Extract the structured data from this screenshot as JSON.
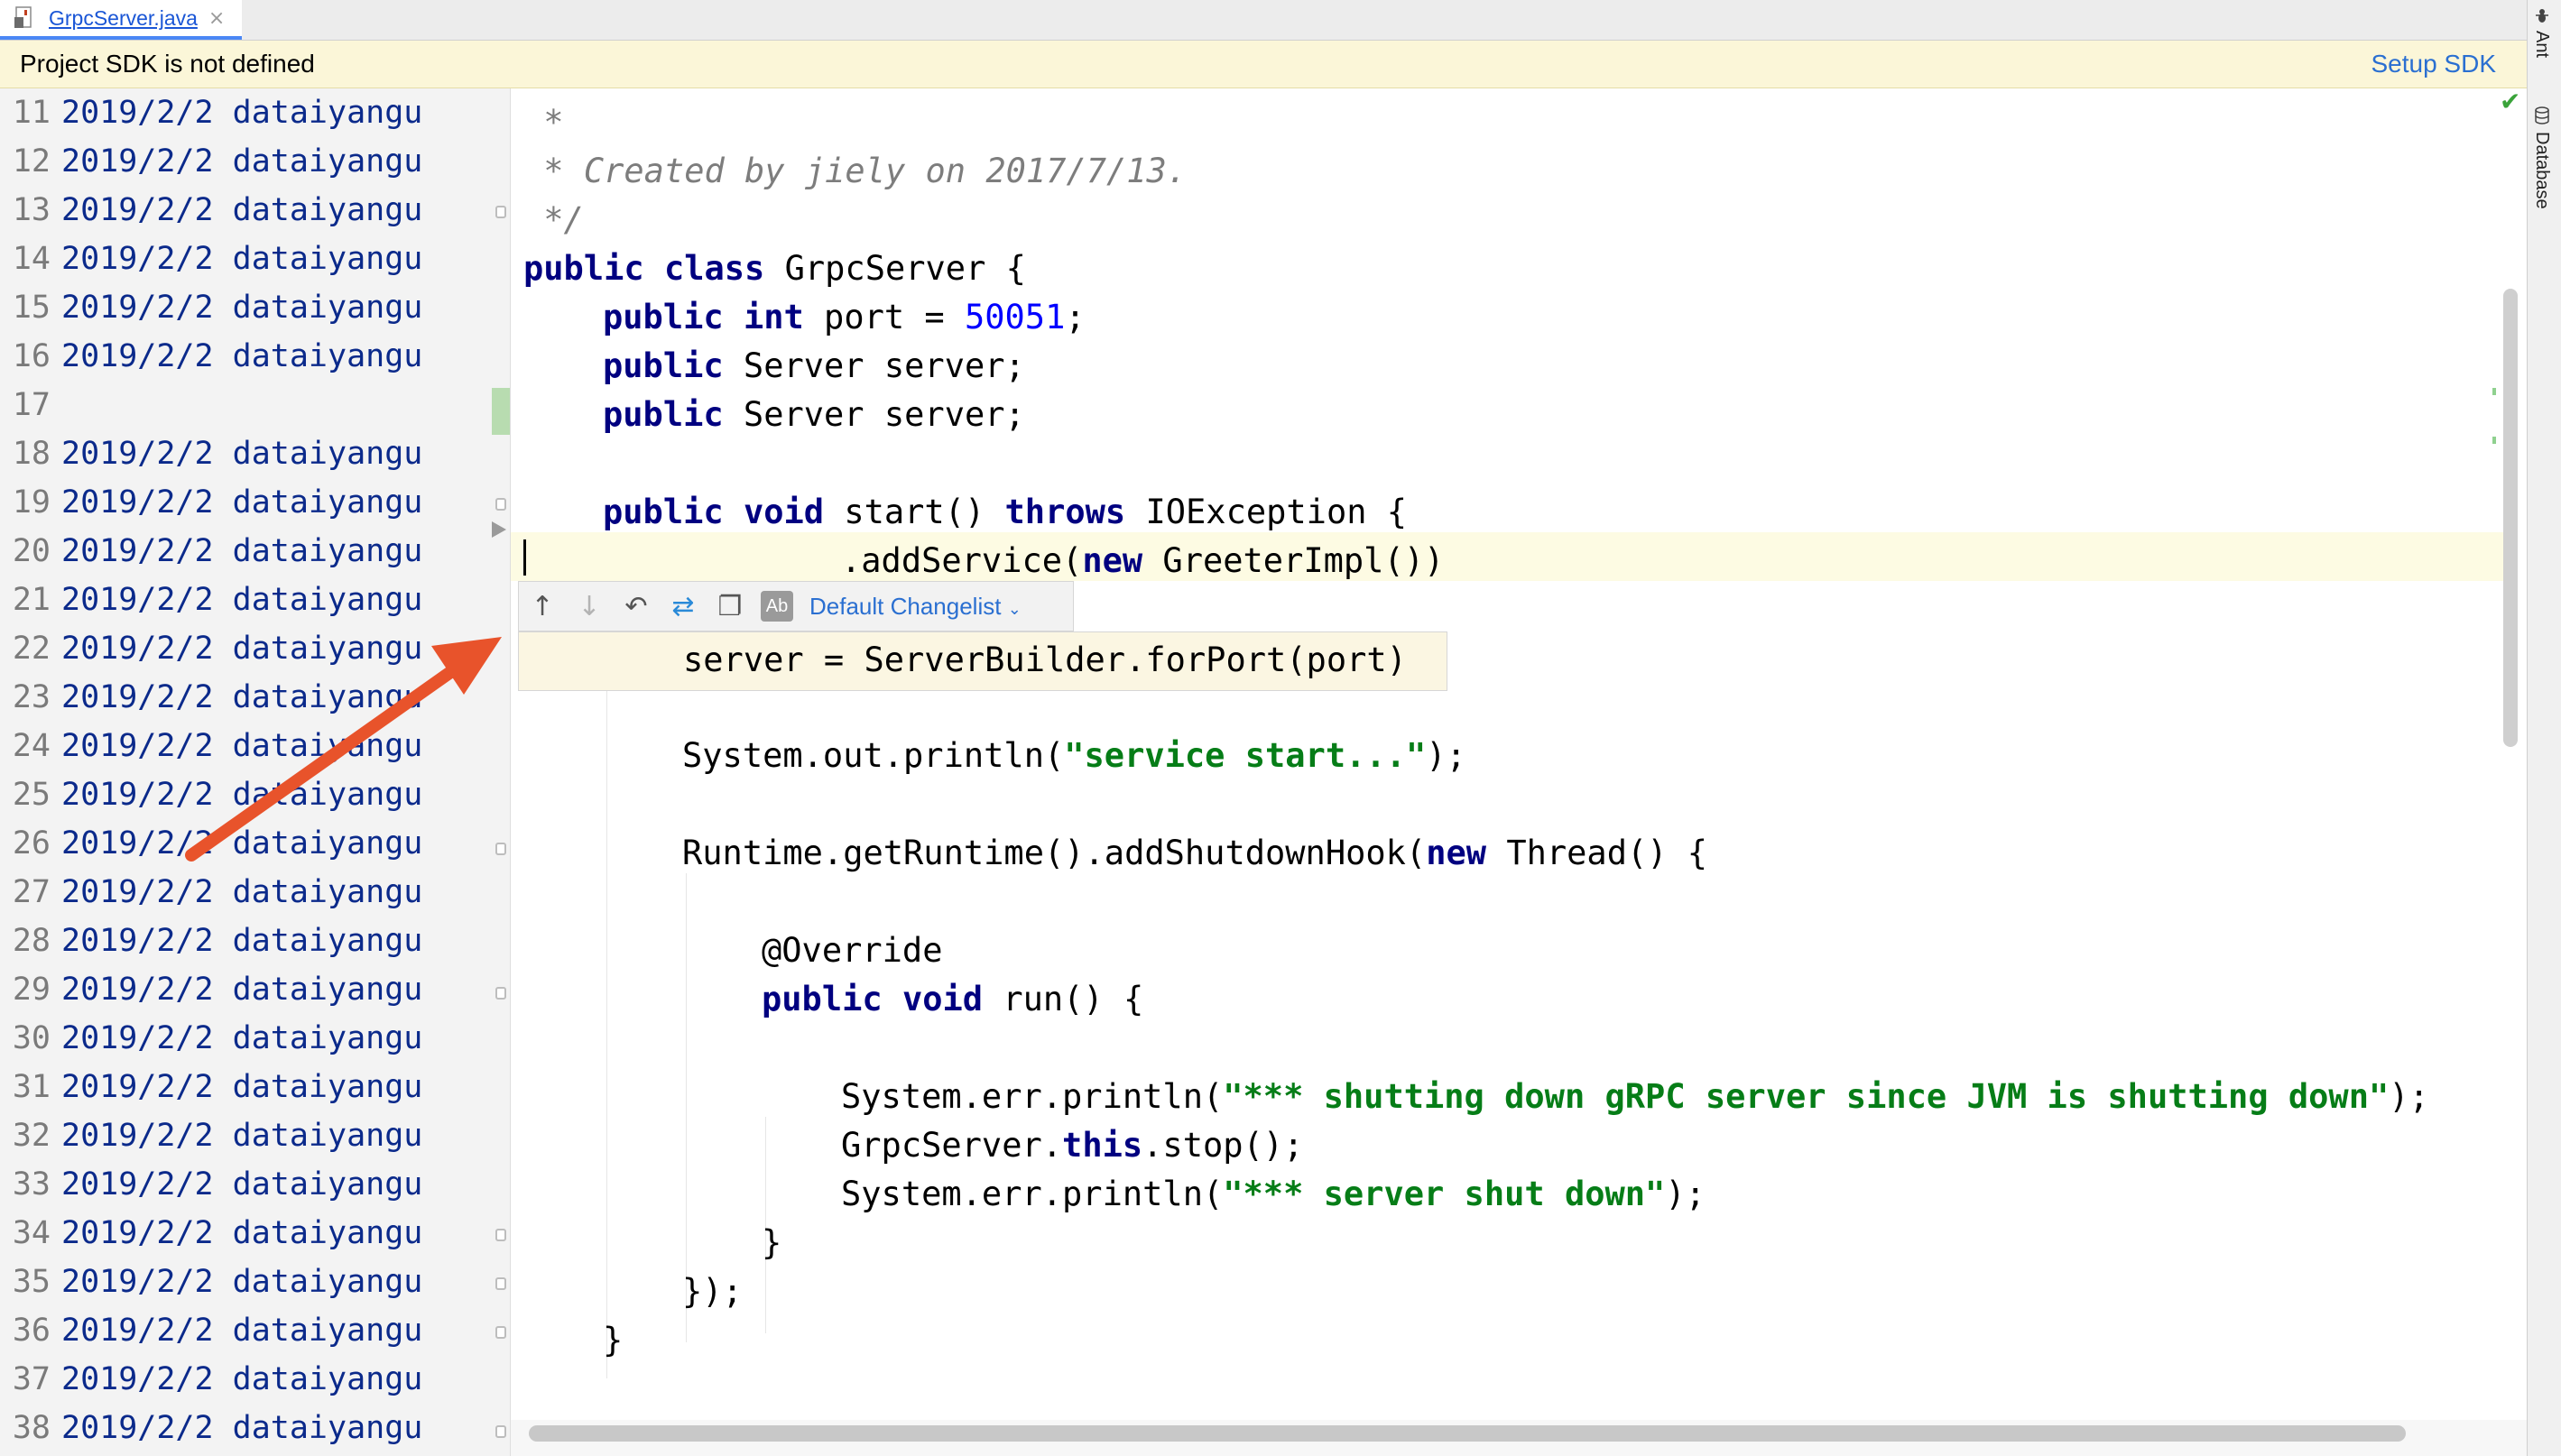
{
  "tab": {
    "file_name": "GrpcServer.java",
    "close_glyph": "×",
    "icon": "java-file-icon"
  },
  "notification": {
    "message": "Project SDK is not defined",
    "action": "Setup SDK"
  },
  "tool_windows": {
    "ant": "Ant",
    "database": "Database"
  },
  "annotations": [
    {
      "line": "11",
      "text": "2019/2/2 dataiyangu"
    },
    {
      "line": "12",
      "text": "2019/2/2 dataiyangu"
    },
    {
      "line": "13",
      "text": "2019/2/2 dataiyangu"
    },
    {
      "line": "14",
      "text": "2019/2/2 dataiyangu"
    },
    {
      "line": "15",
      "text": "2019/2/2 dataiyangu"
    },
    {
      "line": "16",
      "text": "2019/2/2 dataiyangu"
    },
    {
      "line": "17",
      "text": ""
    },
    {
      "line": "18",
      "text": "2019/2/2 dataiyangu"
    },
    {
      "line": "19",
      "text": "2019/2/2 dataiyangu"
    },
    {
      "line": "20",
      "text": "2019/2/2 dataiyangu"
    },
    {
      "line": "21",
      "text": "2019/2/2 dataiyangu"
    },
    {
      "line": "22",
      "text": "2019/2/2 dataiyangu"
    },
    {
      "line": "23",
      "text": "2019/2/2 dataiyangu"
    },
    {
      "line": "24",
      "text": "2019/2/2 dataiyangu"
    },
    {
      "line": "25",
      "text": "2019/2/2 dataiyangu"
    },
    {
      "line": "26",
      "text": "2019/2/2 dataiyangu"
    },
    {
      "line": "27",
      "text": "2019/2/2 dataiyangu"
    },
    {
      "line": "28",
      "text": "2019/2/2 dataiyangu"
    },
    {
      "line": "29",
      "text": "2019/2/2 dataiyangu"
    },
    {
      "line": "30",
      "text": "2019/2/2 dataiyangu"
    },
    {
      "line": "31",
      "text": "2019/2/2 dataiyangu"
    },
    {
      "line": "32",
      "text": "2019/2/2 dataiyangu"
    },
    {
      "line": "33",
      "text": "2019/2/2 dataiyangu"
    },
    {
      "line": "34",
      "text": "2019/2/2 dataiyangu"
    },
    {
      "line": "35",
      "text": "2019/2/2 dataiyangu"
    },
    {
      "line": "36",
      "text": "2019/2/2 dataiyangu"
    },
    {
      "line": "37",
      "text": "2019/2/2 dataiyangu"
    },
    {
      "line": "38",
      "text": "2019/2/2 dataiyangu"
    }
  ],
  "code": {
    "l11_star": " *",
    "l12_comment": " * Created by jiely on 2017/7/13.",
    "l13_end": " */",
    "kw_public": "public",
    "kw_class": "class",
    "kw_int": "int",
    "kw_void": "void",
    "kw_throws": "throws",
    "kw_new": "new",
    "kw_this": "this",
    "l14_rest": " GrpcServer {",
    "l15_pre": " port = ",
    "l15_num": "50051",
    "l15_post": ";",
    "l16_rest": " Server server;",
    "l17_rest": " Server server;",
    "l19_mid": " start() ",
    "l19_rest": " IOException {",
    "l20_pre": ".addService(",
    "l20_rest": " GreeterImpl())",
    "l24_pre": "System.out.println(",
    "l24_str": "\"service start...\"",
    "l24_post": ");",
    "l26_pre": "Runtime.getRuntime().addShutdownHook(",
    "l26_rest": " Thread() {",
    "l28_ann": "@Override",
    "l29_rest": " run() {",
    "l31_pre": "System.err.println(",
    "l31_str": "\"*** shutting down gRPC server since JVM is shutting down\"",
    "l31_post": ");",
    "l32_pre": "GrpcServer.",
    "l32_post": ".stop();",
    "l33_pre": "System.err.println(",
    "l33_str": "\"*** server shut down\"",
    "l33_post": ");",
    "l34": "}",
    "l35": "});",
    "l36": "}"
  },
  "diff_popup": {
    "changelist": "Default Changelist",
    "ab_label": "Ab",
    "old_line": "server = ServerBuilder.forPort(port)",
    "icons": [
      "up-arrow-icon",
      "down-arrow-icon",
      "rollback-icon",
      "diff-icon",
      "copy-icon",
      "ab-icon"
    ]
  },
  "colors": {
    "keyword": "#000080",
    "number": "#0000ff",
    "string": "#067d17",
    "comment": "#7d7d7d",
    "annotation_text": "#0b2a8b",
    "arrow": "#e8532b",
    "link": "#2a6fd1"
  }
}
